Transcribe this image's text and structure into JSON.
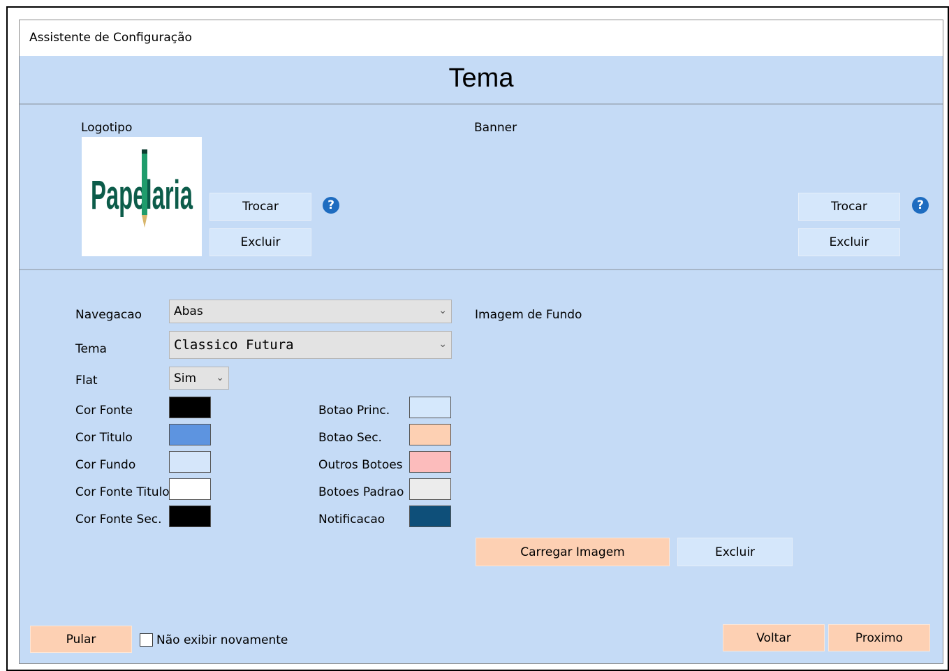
{
  "window": {
    "title": "Assistente de Configuração"
  },
  "page": {
    "title": "Tema"
  },
  "logo": {
    "label": "Logotipo",
    "image_text": "Papelaria",
    "change_label": "Trocar",
    "delete_label": "Excluir",
    "help_icon": "question-circle-icon"
  },
  "banner": {
    "label": "Banner",
    "change_label": "Trocar",
    "delete_label": "Excluir",
    "help_icon": "question-circle-icon"
  },
  "form": {
    "navegacao": {
      "label": "Navegacao",
      "value": "Abas"
    },
    "tema": {
      "label": "Tema",
      "value": "Classico Futura"
    },
    "flat": {
      "label": "Flat",
      "value": "Sim"
    }
  },
  "colors_left": [
    {
      "label": "Cor Fonte",
      "color": "#000000"
    },
    {
      "label": "Cor Titulo",
      "color": "#5d94e0"
    },
    {
      "label": "Cor Fundo",
      "color": "#d5e6fa"
    },
    {
      "label": "Cor Fonte Titulo",
      "color": "#ffffff"
    },
    {
      "label": "Cor Fonte Sec.",
      "color": "#000000"
    }
  ],
  "colors_right": [
    {
      "label": "Botao Princ.",
      "color": "#d5e8fc"
    },
    {
      "label": "Botao Sec.",
      "color": "#fdd0b3"
    },
    {
      "label": "Outros Botoes",
      "color": "#fcbcbc"
    },
    {
      "label": "Botoes Padrao",
      "color": "#ececec"
    },
    {
      "label": "Notificacao",
      "color": "#0e4f79"
    }
  ],
  "background_image": {
    "label": "Imagem de Fundo",
    "load_label": "Carregar Imagem",
    "delete_label": "Excluir"
  },
  "footer": {
    "skip_label": "Pular",
    "dont_show_label": "Não exibir novamente",
    "dont_show_checked": false,
    "back_label": "Voltar",
    "next_label": "Proximo"
  }
}
